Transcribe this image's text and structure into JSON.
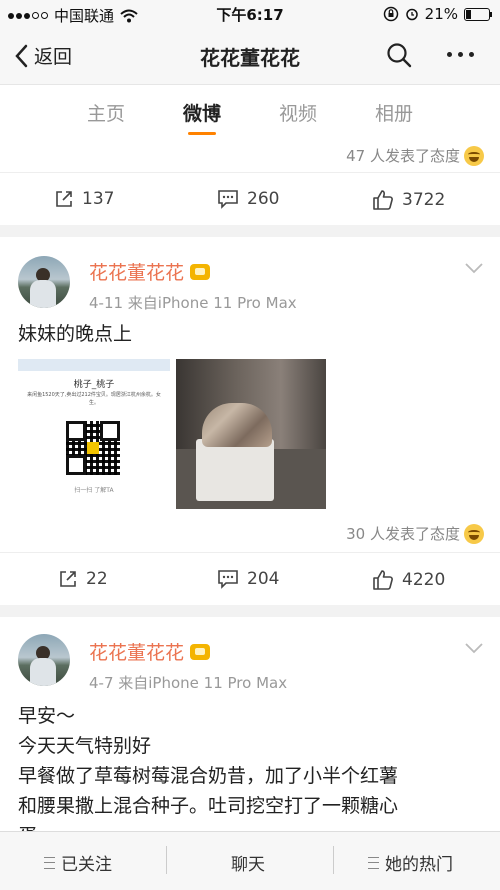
{
  "status_bar": {
    "carrier": "中国联通",
    "time": "下午6:17",
    "battery": "21%",
    "battery_fraction": 0.21
  },
  "nav": {
    "back_label": "返回",
    "title": "花花董花花"
  },
  "tabs": [
    "主页",
    "微博",
    "视频",
    "相册"
  ],
  "active_tab": "微博",
  "posts": [
    {
      "reactions": "47 人发表了态度",
      "shares": "137",
      "comments": "260",
      "likes": "3722"
    },
    {
      "user": "花花董花花",
      "meta": "4-11  来自iPhone 11 Pro Max",
      "text": "妹妹的晚点上",
      "image1": {
        "name": "桃子_桃子",
        "desc": "来闲鱼1520天了,卖出过212件宝贝。现居浙江杭州余杭。女生。",
        "scan": "扫一扫 了解TA"
      },
      "reactions": "30 人发表了态度",
      "shares": "22",
      "comments": "204",
      "likes": "4220"
    },
    {
      "user": "花花董花花",
      "meta": "4-7  来自iPhone 11 Pro Max",
      "lines": [
        "早安～",
        "今天天气特别好",
        "早餐做了草莓树莓混合奶昔，加了小半个红薯",
        "和腰果撒上混合种子。吐司挖空打了一颗糖心",
        "蛋"
      ]
    }
  ],
  "bottom_bar": {
    "follow": "已关注",
    "chat": "聊天",
    "hot": "她的热门"
  },
  "colors": {
    "accent": "#ff8200",
    "username": "#eb7350"
  }
}
